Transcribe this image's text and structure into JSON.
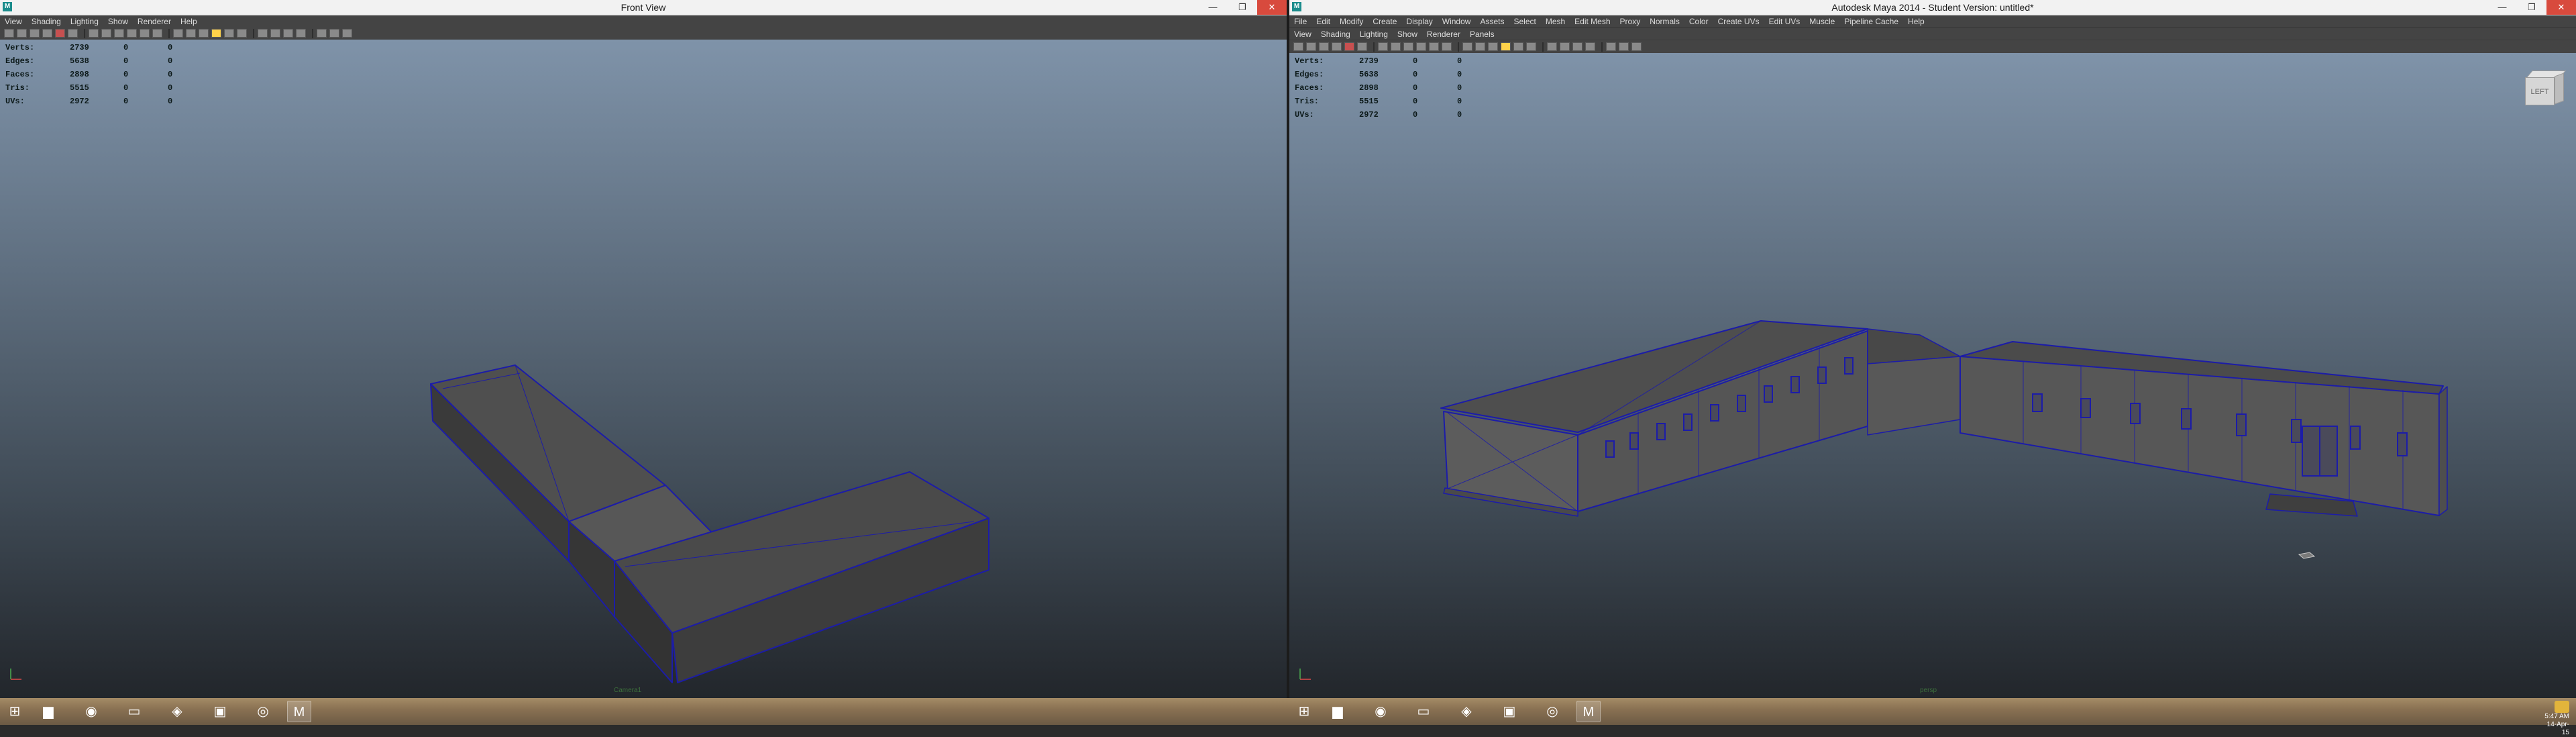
{
  "left_window": {
    "title": "Front View",
    "menu": [
      "View",
      "Shading",
      "Lighting",
      "Show",
      "Renderer",
      "Help"
    ],
    "hud": {
      "rows": [
        {
          "label": "Verts:",
          "value": "2739",
          "c2": "0",
          "c3": "0"
        },
        {
          "label": "Edges:",
          "value": "5638",
          "c2": "0",
          "c3": "0"
        },
        {
          "label": "Faces:",
          "value": "2898",
          "c2": "0",
          "c3": "0"
        },
        {
          "label": "Tris:",
          "value": "5515",
          "c2": "0",
          "c3": "0"
        },
        {
          "label": "UVs:",
          "value": "2972",
          "c2": "0",
          "c3": "0"
        }
      ]
    },
    "camera_label": "Camera1"
  },
  "right_window": {
    "title": "Autodesk Maya 2014 - Student Version: untitled*",
    "main_menu": [
      "File",
      "Edit",
      "Modify",
      "Create",
      "Display",
      "Window",
      "Assets",
      "Select",
      "Mesh",
      "Edit Mesh",
      "Proxy",
      "Normals",
      "Color",
      "Create UVs",
      "Edit UVs",
      "Muscle",
      "Pipeline Cache",
      "Help"
    ],
    "panel_menu": [
      "View",
      "Shading",
      "Lighting",
      "Show",
      "Renderer",
      "Panels"
    ],
    "hud": {
      "rows": [
        {
          "label": "Verts:",
          "value": "2739",
          "c2": "0",
          "c3": "0"
        },
        {
          "label": "Edges:",
          "value": "5638",
          "c2": "0",
          "c3": "0"
        },
        {
          "label": "Faces:",
          "value": "2898",
          "c2": "0",
          "c3": "0"
        },
        {
          "label": "Tris:",
          "value": "5515",
          "c2": "0",
          "c3": "0"
        },
        {
          "label": "UVs:",
          "value": "2972",
          "c2": "0",
          "c3": "0"
        }
      ]
    },
    "viewcube_label": "LEFT",
    "camera_label": "persp"
  },
  "taskbar": {
    "time": "5:47 AM",
    "date": "14-Apr-15"
  },
  "icons": {
    "start": "windows-start-icon",
    "explorer": "folder-icon",
    "browser": "firefox-icon",
    "unity": "unity-icon",
    "maya": "maya-icon"
  },
  "colors": {
    "wire": "#1c1ca8",
    "mesh": "#595959",
    "accent_close": "#d84a3d"
  }
}
